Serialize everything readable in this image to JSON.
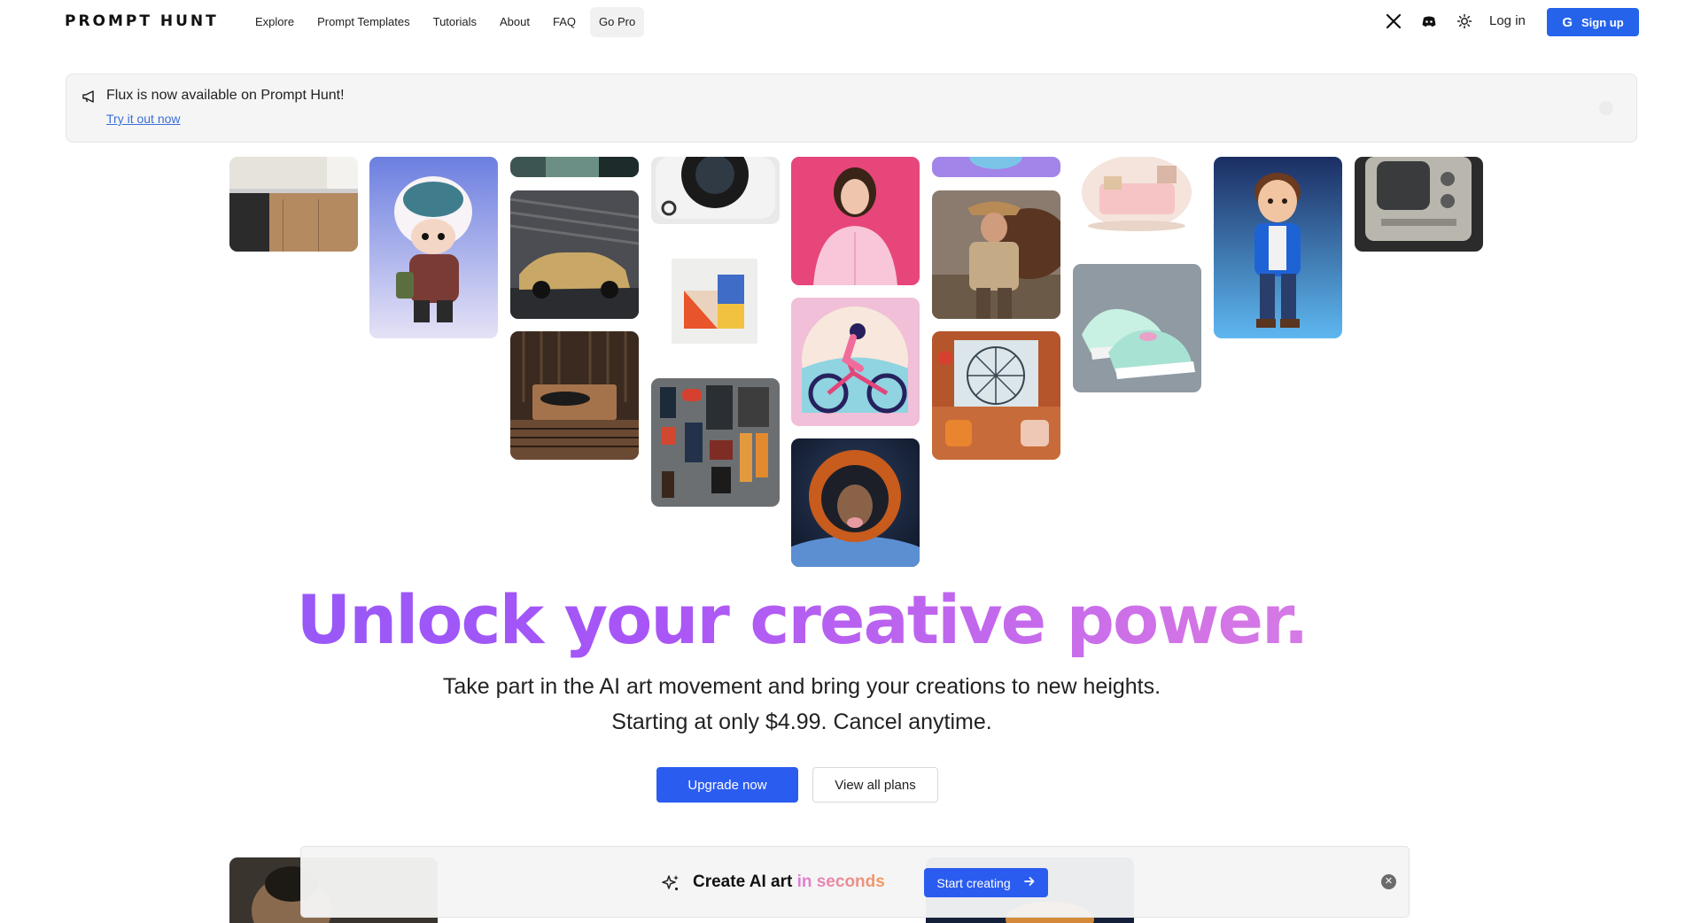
{
  "nav": {
    "logo": "PROMPT HUNT",
    "links": [
      {
        "label": "Explore"
      },
      {
        "label": "Prompt Templates"
      },
      {
        "label": "Tutorials"
      },
      {
        "label": "About"
      },
      {
        "label": "FAQ"
      },
      {
        "label": "Go Pro"
      }
    ],
    "icons": [
      "x-twitter-icon",
      "discord-icon",
      "sun-icon"
    ],
    "login_label": "Log in",
    "signup_label": "Sign up",
    "signup_icon": "google-icon"
  },
  "banner": {
    "icon": "megaphone-icon",
    "text": "Flux is now available on Prompt Hunt!",
    "link": "Try it out now"
  },
  "hero": {
    "title": "Unlock your creative power.",
    "subtitle_line1": "Take part in the AI art movement and bring your creations to new heights.",
    "subtitle_line2": "Starting at only $4.99. Cancel anytime.",
    "upgrade_label": "Upgrade now",
    "plans_label": "View all plans"
  },
  "bottom_bar": {
    "icon": "sparkles-icon",
    "text_prefix": "Create AI art",
    "text_highlight": "in seconds",
    "button_label": "Start creating",
    "button_icon": "arrow-right-icon",
    "close_icon": "close-icon"
  },
  "colors": {
    "primary": "#2b5cf0",
    "gradient_start": "#8b5cf6",
    "gradient_end": "#d98be8"
  }
}
